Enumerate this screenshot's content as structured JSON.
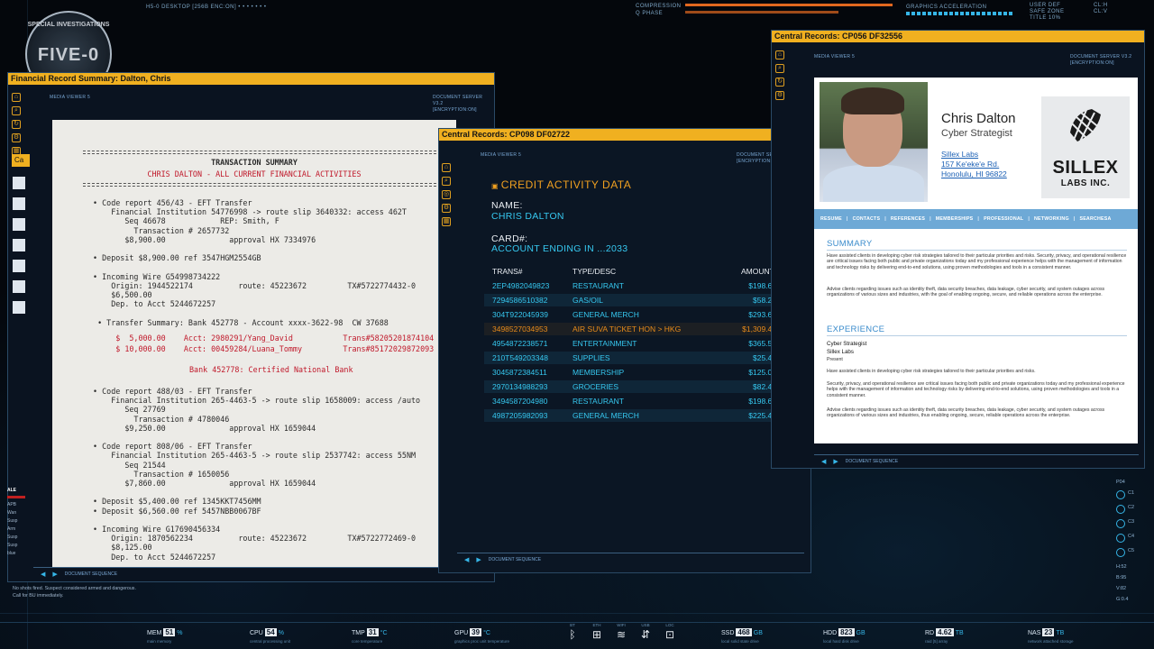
{
  "hud_top": {
    "desktop": "H5-0 DESKTOP [256B ENC:ON] • • • • • • •",
    "compression": "COMPRESSION",
    "q_phase": "Q PHASE",
    "graphics": "GRAPHICS ACCELERATION",
    "user_def": "USER DEF",
    "safe_zone": "SAFE ZONE",
    "title_pct": "TITLE 10%",
    "cl_h": "CL:H",
    "cl_v": "CL:V"
  },
  "badge": {
    "ring": "SPECIAL INVESTIGATIONS",
    "big": "FIVE-0"
  },
  "financial_window": {
    "title": "Financial Record Summary: Dalton, Chris",
    "media": "MEDIA VIEWER 5",
    "server": "DOCUMENT SERVER V3.2",
    "encryption": "[ENCRYPTION:ON]",
    "footer": "DOCUMENT SEQUENCE",
    "tab_label": "Ca",
    "doc": {
      "heading": "TRANSACTION SUMMARY",
      "subheading": "CHRIS DALTON - ALL CURRENT FINANCIAL ACTIVITIES",
      "lines": [
        " • Code report 456/43 - EFT Transfer",
        "     Financial Institution 54776998 -> route slip 3640332: access 462T",
        "        Seq 46678            REP: Smith, F",
        "          Transaction # 2657732",
        "        $8,900.00              approval HX 7334976",
        "",
        " • Deposit $8,900.00 ref 3547HGM2554GB",
        "",
        " • Incoming Wire G54998734222",
        "     Origin: 1944522174          route: 45223672         TX#5722774432-0",
        "     $6,500.00",
        "     Dep. to Acct 5244672257",
        "",
        "  • Transfer Summary: Bank 452778 - Account xxxx-3622-98  CW 37688"
      ],
      "red_lines": [
        "      $  5,000.00    Acct: 2980291/Yang_David           Trans#58205201874104",
        "      $ 10,000.00    Acct: 00459284/Luana_Tommy         Trans#85172029872093"
      ],
      "bank_note": "Bank 452778: Certified National Bank",
      "lines2": [
        " • Code report 488/03 - EFT Transfer",
        "     Financial Institution 265-4463-5 -> route slip 1658009: access /auto",
        "        Seq 27769",
        "          Transaction # 4780046",
        "        $9,250.00              approval HX 1659044",
        "",
        " • Code report 808/06 - EFT Transfer",
        "     Financial Institution 265-4463-5 -> route slip 2537742: access 55NM",
        "        Seq 21544",
        "          Transaction # 1650056",
        "        $7,860.00              approval HX 1659044",
        "",
        " • Deposit $5,400.00 ref 1345KKT7456MM",
        " • Deposit $6,560.00 ref 5457NBB0067BF",
        "",
        " • Incoming Wire G17690456334",
        "     Origin: 1870562234          route: 45223672         TX#5722772469-0",
        "     $8,125.00",
        "     Dep. to Acct 5244672257"
      ]
    }
  },
  "credit_window": {
    "title": "Central Records: CP098 DF02722",
    "media": "MEDIA VIEWER 5",
    "server": "DOCUMENT SERVER V3.2",
    "encryption": "[ENCRYPTION:ON]",
    "footer": "DOCUMENT SEQUENCE",
    "heading": "CREDIT ACTIVITY DATA",
    "name_label": "NAME:",
    "name_value": "CHRIS DALTON",
    "card_label": "CARD#:",
    "card_value": "ACCOUNT ENDING IN ...2033",
    "col_trans": "TRANS#",
    "col_type": "TYPE/DESC",
    "col_amount": "AMOUNT",
    "rows": [
      {
        "trans": "2EP4982049823",
        "type": "RESTAURANT",
        "amount": "$198.65"
      },
      {
        "trans": "7294586510382",
        "type": "GAS/OIL",
        "amount": "$58.21"
      },
      {
        "trans": "304T922045939",
        "type": "GENERAL MERCH",
        "amount": "$293.64"
      },
      {
        "trans": "3498527034953",
        "type": "AIR SUVA TICKET  HON > HKG",
        "amount": "$1,309.47"
      },
      {
        "trans": "4954872238571",
        "type": "ENTERTAINMENT",
        "amount": "$365.50"
      },
      {
        "trans": "210T549203348",
        "type": "SUPPLIES",
        "amount": "$25.49"
      },
      {
        "trans": "3045872384511",
        "type": "MEMBERSHIP",
        "amount": "$125.00"
      },
      {
        "trans": "2970134988293",
        "type": "GROCERIES",
        "amount": "$82.45"
      },
      {
        "trans": "3494587204980",
        "type": "RESTAURANT",
        "amount": "$198.61"
      },
      {
        "trans": "4987205982093",
        "type": "GENERAL MERCH",
        "amount": "$225.45"
      }
    ]
  },
  "profile_window": {
    "title": "Central Records: CP056 DF32556",
    "media": "MEDIA VIEWER 5",
    "server": "DOCUMENT SERVER V3.2",
    "encryption": "[ENCRYPTION:ON]",
    "footer": "DOCUMENT SEQUENCE",
    "name": "Chris Dalton",
    "job": "Cyber Strategist",
    "company": "Sillex Labs",
    "street": "157 Ke'eke'e Rd.",
    "city": "Honolulu, HI 96822",
    "logo_line1": "SILLEX",
    "logo_line2": "LABS INC.",
    "nav": [
      "RESUME",
      "CONTACTS",
      "REFERENCES",
      "MEMBERSHIPS",
      "PROFESSIONAL",
      "NETWORKING",
      "SEARCHESA"
    ],
    "summary_heading": "SUMMARY",
    "summary_p1": "Have assisted clients in developing cyber risk strategies tailored to their particular priorities and risks. Security, privacy, and operational resilience are critical issues facing both public and private organizations today and my professional experience helps with the management of information and technology risks by delivering end-to-end solutions, using proven methodologies and tools in a consistent manner.",
    "summary_p2": "Advise clients regarding issues such as identity theft, data security breaches, data leakage, cyber security, and system outages across organizations of various sizes and industries, with the goal of enabling ongoing, secure, and reliable operations across the enterprise.",
    "experience_heading": "EXPERIENCE",
    "exp_title": "Cyber Strategist",
    "exp_company": "Sillex Labs",
    "exp_period": "Present",
    "exp_p1": "Have assisted clients in developing cyber risk strategies tailored to their particular priorities and risks.",
    "exp_p2": "Security, privacy, and operational resilience are critical issues facing both public and private organizations today and my professional experience helps with the management of information and technology risks by delivering end-to-end solutions, using proven methodologies and tools in a consistent manner.",
    "exp_p3": "Advise clients regarding issues such as identity theft, data security breaches, data leakage, cyber security, and system outages across organizations of various sizes and industries, thus enabling ongoing, secure, reliable operations across the enterprise."
  },
  "left_panel": {
    "alert": "ALE",
    "lines": [
      "APB",
      "Wan",
      "Susp",
      "Arm",
      "Susp",
      "Susp",
      "blue"
    ],
    "note": "No shots fired. Suspect considered armed and dangerous. Call for BU immediately."
  },
  "right_hud": {
    "p04": "P04",
    "c1": "C1",
    "c2": "C2",
    "c3": "C3",
    "c4": "C4",
    "c5": "C5",
    "h52": "H:52",
    "b95": "B:95",
    "v82": "V:82",
    "g04": "G:0.4"
  },
  "bottom_hud": {
    "stats": [
      {
        "label": "MEM",
        "value": "51",
        "unit": "%",
        "sub": "main memory"
      },
      {
        "label": "CPU",
        "value": "54",
        "unit": "%",
        "sub": "central processing unit"
      },
      {
        "label": "TMP",
        "value": "31",
        "unit": "°C",
        "sub": "core temperature"
      },
      {
        "label": "GPU",
        "value": "39",
        "unit": "°C",
        "sub": "graphics proc unit temperature"
      },
      {
        "label": "SSD",
        "value": "468",
        "unit": "GB",
        "sub": "local solid state drive"
      },
      {
        "label": "HDD",
        "value": "823",
        "unit": "GB",
        "sub": "local hard disk drive"
      },
      {
        "label": "RD",
        "value": "4.62",
        "unit": "TB",
        "sub": "raid [5] array"
      },
      {
        "label": "NAS",
        "value": "23",
        "unit": "TB",
        "sub": "network attached storage"
      }
    ],
    "icon_labels": [
      "BT",
      "ETH",
      "WIFI",
      "USB",
      "LOC"
    ]
  }
}
